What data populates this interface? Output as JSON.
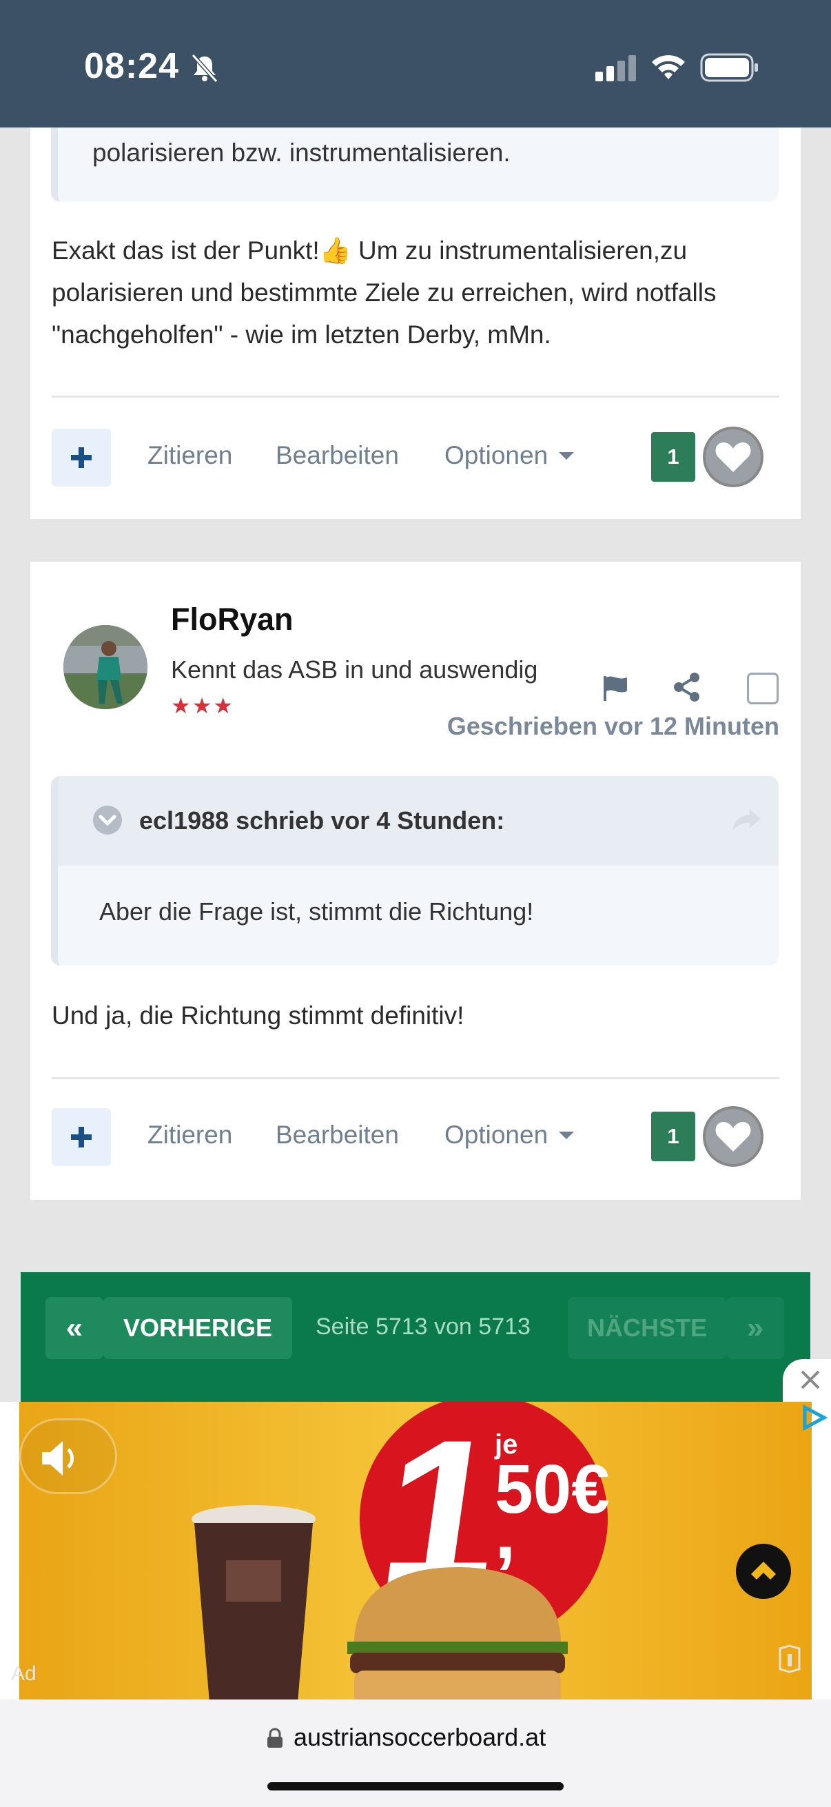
{
  "status": {
    "time": "08:24"
  },
  "post1": {
    "quote_tail": "polarisieren bzw. instrumentalisieren.",
    "text_lines": [
      "Exakt das ist der Punkt!👍 Um zu instrumentalisieren,zu",
      "polarisieren und bestimmte Ziele zu erreichen, wird notfalls",
      "\"nachgeholfen\" - wie im letzten Derby, mMn."
    ],
    "actions": {
      "quote": "Zitieren",
      "edit": "Bearbeiten",
      "options": "Optionen"
    },
    "likes": "1"
  },
  "post2": {
    "author": "FloRyan",
    "rank_title": "Kennt das ASB in und auswendig",
    "stars": "★★★",
    "posted": "Geschrieben vor 12 Minuten",
    "quote_header": "ecl1988 schrieb vor 4 Stunden:",
    "quote_body": "Aber die Frage ist, stimmt die Richtung!",
    "text": "Und ja, die Richtung stimmt definitiv!",
    "actions": {
      "quote": "Zitieren",
      "edit": "Bearbeiten",
      "options": "Optionen"
    },
    "likes": "1"
  },
  "pagination": {
    "first": "«",
    "prev": "VORHERIGE",
    "page_info": "Seite 5713 von 5713",
    "next": "NÄCHSTE",
    "last": "»"
  },
  "ad": {
    "label": "Ad",
    "price_big": "1",
    "price_small": "50€",
    "price_prefix": "je",
    "price_comma": ","
  },
  "browser": {
    "url": "austriansoccerboard.at"
  },
  "colors": {
    "statusbar": "#3d5166",
    "green": "#0b7a4b",
    "like_green": "#2e7d59",
    "ad_yellow": "#f2b61a",
    "ad_red": "#d8141f"
  }
}
